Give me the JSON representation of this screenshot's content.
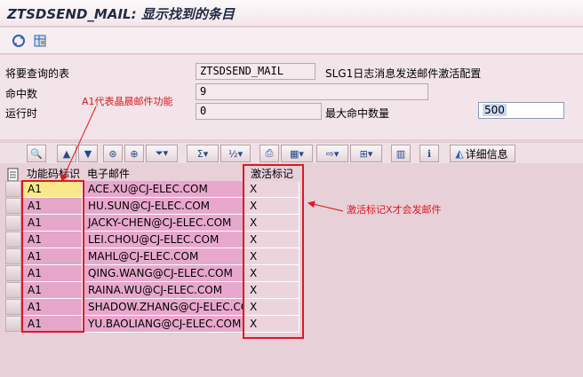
{
  "window": {
    "title": "ZTSDSEND_MAIL: 显示找到的条目"
  },
  "app_toolbar": {
    "icons": [
      "refresh-icon",
      "table-settings-icon"
    ]
  },
  "form": {
    "table_label": "将要查询的表",
    "table_value": "ZTSDSEND_MAIL",
    "table_desc": "SLG1日志消息发送邮件激活配置",
    "hits_label": "命中数",
    "hits_value": "9",
    "runtime_label": "运行时",
    "runtime_value": "0",
    "max_hits_label": "最大命中数量",
    "max_hits_value": "500"
  },
  "grid_toolbar": {
    "details_label": "详细信息",
    "buttons": [
      "details-view-icon",
      "sort-ascending-icon",
      "sort-descending-icon",
      "find-icon",
      "find-next-icon",
      "filter-icon",
      "sum-icon",
      "subtotal-icon",
      "print-icon",
      "layout-icon",
      "export-icon",
      "select-layout-icon",
      "chart-icon",
      "info-icon",
      "details-icon"
    ]
  },
  "grid": {
    "columns": [
      "功能码标识",
      "电子邮件",
      "激活标记"
    ],
    "rows": [
      {
        "code": "A1",
        "email": "ACE.XU@CJ-ELEC.COM",
        "flag": "X"
      },
      {
        "code": "A1",
        "email": "HU.SUN@CJ-ELEC.COM",
        "flag": "X"
      },
      {
        "code": "A1",
        "email": "JACKY-CHEN@CJ-ELEC.COM",
        "flag": "X"
      },
      {
        "code": "A1",
        "email": "LEI.CHOU@CJ-ELEC.COM",
        "flag": "X"
      },
      {
        "code": "A1",
        "email": "MAHL@CJ-ELEC.COM",
        "flag": "X"
      },
      {
        "code": "A1",
        "email": "QING.WANG@CJ-ELEC.COM",
        "flag": "X"
      },
      {
        "code": "A1",
        "email": "RAINA.WU@CJ-ELEC.COM",
        "flag": "X"
      },
      {
        "code": "A1",
        "email": "SHADOW.ZHANG@CJ-ELEC.COM",
        "flag": "X"
      },
      {
        "code": "A1",
        "email": "YU.BAOLIANG@CJ-ELEC.COM",
        "flag": "X"
      }
    ]
  },
  "annotations": {
    "a1_note": "A1代表晶晨邮件功能",
    "x_note": "激活标记X才会发邮件",
    "color": "#e0181e"
  }
}
